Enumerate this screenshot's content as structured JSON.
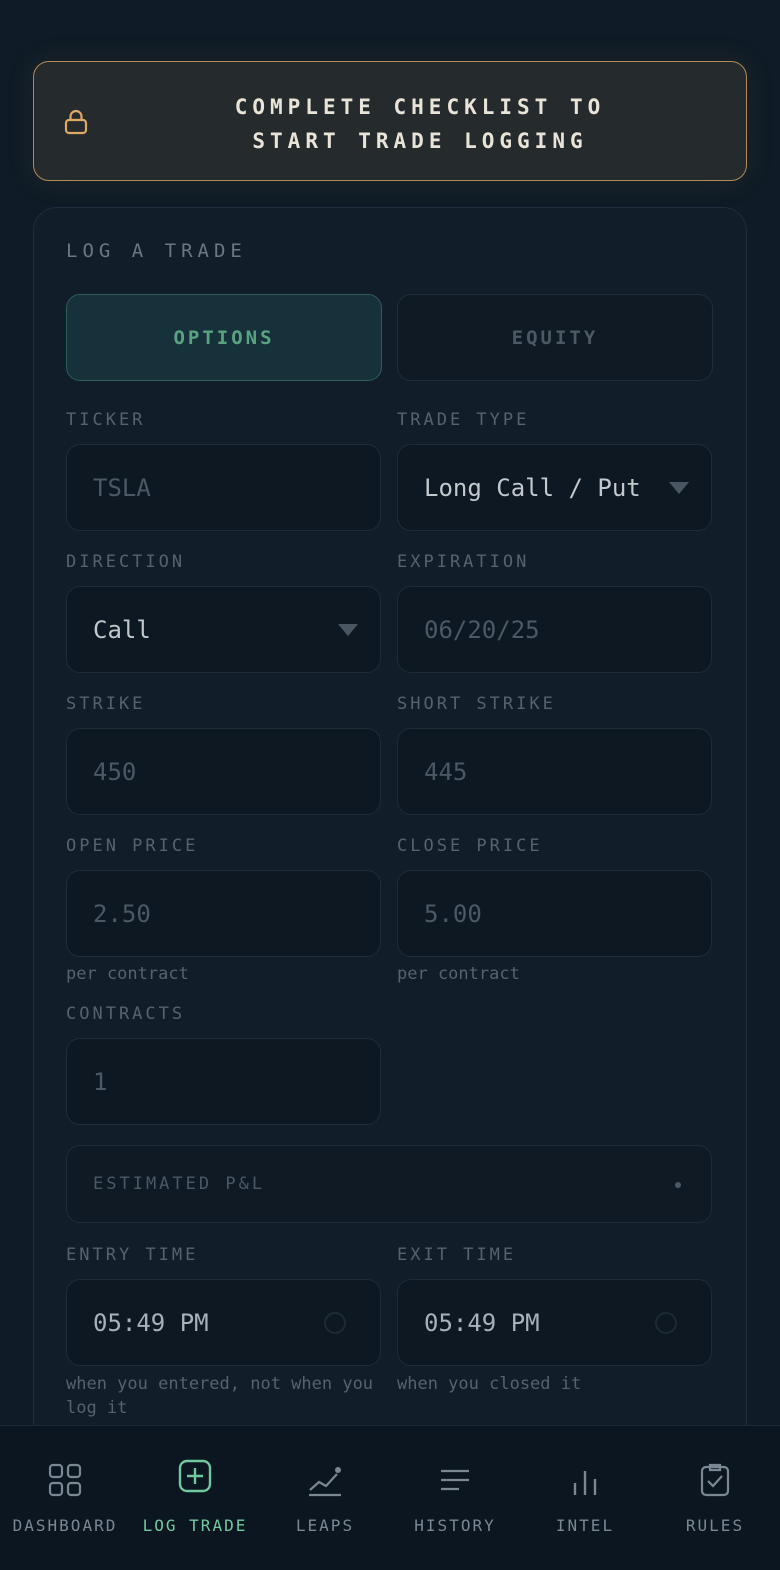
{
  "banner": {
    "line1": "COMPLETE CHECKLIST TO",
    "line2": "START TRADE LOGGING",
    "icon": "lock-icon",
    "accent": "#b08a58"
  },
  "form": {
    "title": "LOG A TRADE",
    "segments": {
      "options": "OPTIONS",
      "equity": "EQUITY",
      "active": "options"
    },
    "ticker": {
      "label": "TICKER",
      "placeholder": "TSLA"
    },
    "trade_type": {
      "label": "TRADE TYPE",
      "value": "Long Call / Put"
    },
    "direction": {
      "label": "DIRECTION",
      "value": "Call"
    },
    "expiration": {
      "label": "EXPIRATION",
      "placeholder": "06/20/25"
    },
    "strike": {
      "label": "STRIKE",
      "placeholder": "450"
    },
    "short_strike": {
      "label": "SHORT STRIKE",
      "placeholder": "445"
    },
    "open_price": {
      "label": "OPEN PRICE",
      "placeholder": "2.50",
      "hint": "per contract"
    },
    "close_price": {
      "label": "CLOSE PRICE",
      "placeholder": "5.00",
      "hint": "per contract"
    },
    "contracts": {
      "label": "CONTRACTS",
      "placeholder": "1"
    },
    "estimated_pl": {
      "label": "ESTIMATED P&L"
    },
    "entry_time": {
      "label": "ENTRY TIME",
      "value": "05:49 PM",
      "hint": "when you entered, not when you log it"
    },
    "exit_time": {
      "label": "EXIT TIME",
      "value": "05:49 PM",
      "hint": "when you closed it"
    }
  },
  "nav": {
    "items": [
      {
        "label": "DASHBOARD",
        "icon": "grid-icon"
      },
      {
        "label": "LOG TRADE",
        "icon": "plus-square-icon"
      },
      {
        "label": "LEAPS",
        "icon": "trend-line-icon"
      },
      {
        "label": "HISTORY",
        "icon": "list-lines-icon"
      },
      {
        "label": "INTEL",
        "icon": "bar-chart-icon"
      },
      {
        "label": "RULES",
        "icon": "clipboard-check-icon"
      }
    ],
    "active_index": 1,
    "active_color": "#72c9a0"
  }
}
